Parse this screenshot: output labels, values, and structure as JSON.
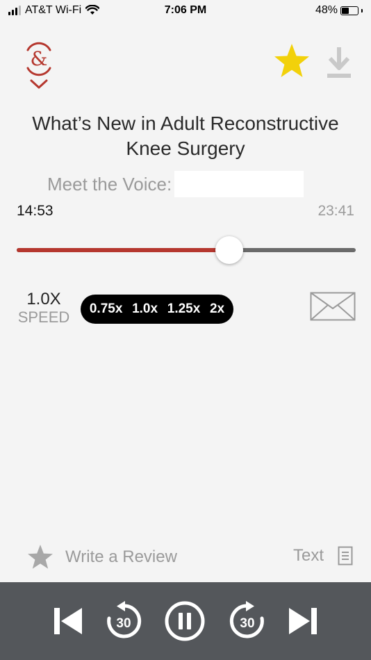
{
  "status_bar": {
    "carrier": "AT&T Wi-Fi",
    "time": "7:06 PM",
    "battery_percent": "48%",
    "battery_level": 0.48
  },
  "header": {
    "favorite_icon": "star-icon",
    "favorite_color": "#f2d10a",
    "download_icon": "download-icon"
  },
  "title": "What’s New in Adult Reconstructive Knee Surgery",
  "voice": {
    "label": "Meet the Voice:"
  },
  "player": {
    "elapsed": "14:53",
    "total": "23:41",
    "progress": 0.628,
    "accent_color": "#b5372e"
  },
  "speed": {
    "value": "1.0X",
    "label": "SPEED",
    "options": [
      "0.75x",
      "1.0x",
      "1.25x",
      "2x"
    ]
  },
  "footer_actions": {
    "review_label": "Write a Review",
    "text_label": "Text"
  },
  "controls": {
    "skip_back_seconds": "30",
    "skip_forward_seconds": "30",
    "buttons": [
      "previous-icon",
      "rewind-30-icon",
      "pause-icon",
      "forward-30-icon",
      "next-icon"
    ]
  }
}
